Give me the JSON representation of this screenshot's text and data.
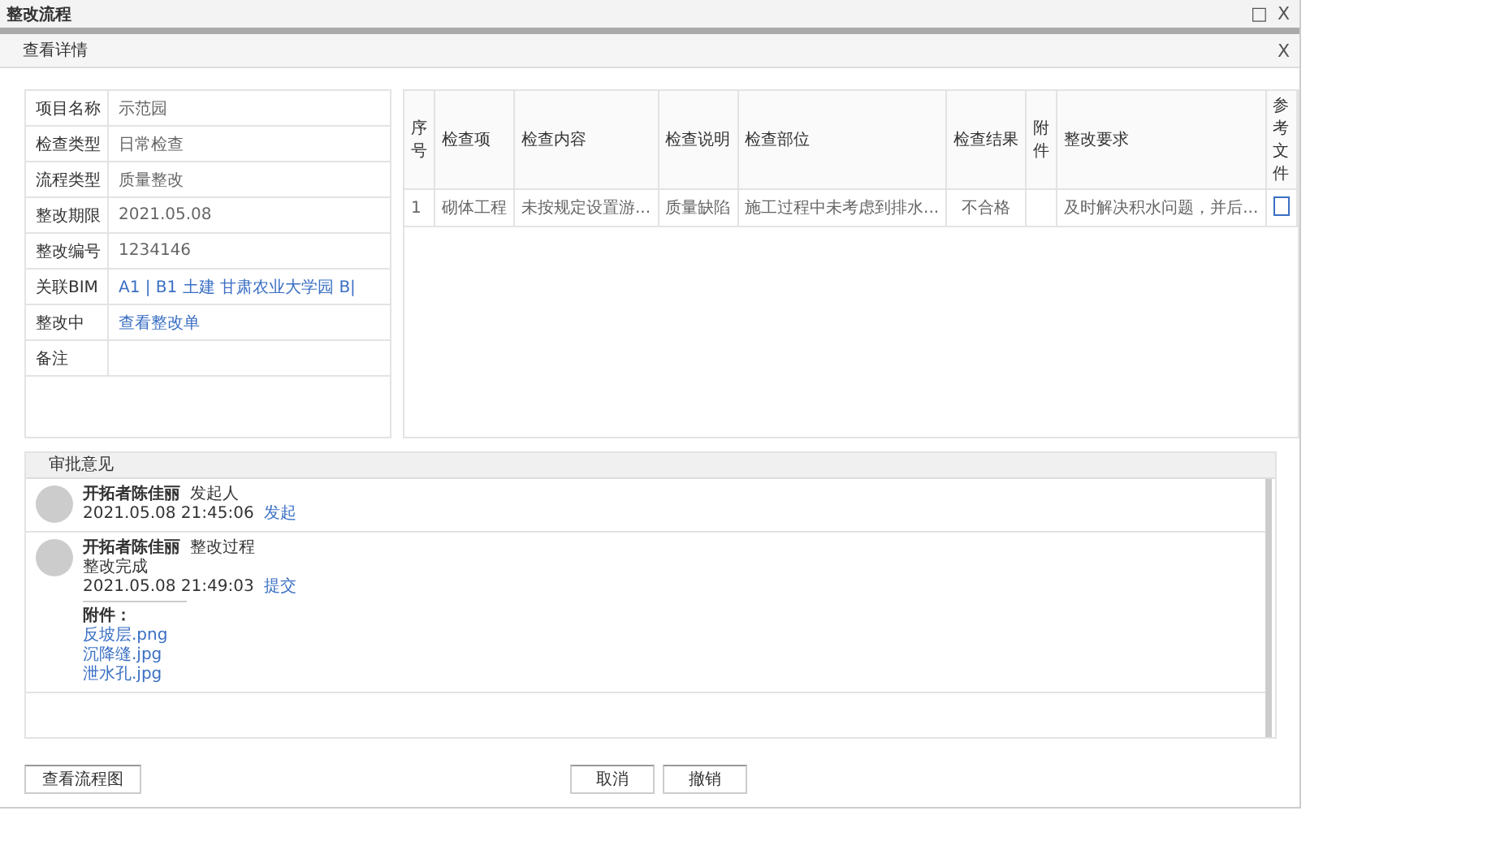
{
  "window": {
    "title": "整改流程",
    "controls": [
      "□",
      "X"
    ]
  },
  "dialog": {
    "title": "查看详情",
    "close": "X"
  },
  "info": [
    {
      "label": "项目名称",
      "value": "示范园",
      "kind": "text"
    },
    {
      "label": "检查类型",
      "value": "日常检查",
      "kind": "text"
    },
    {
      "label": "流程类型",
      "value": "质量整改",
      "kind": "text"
    },
    {
      "label": "整改期限",
      "value": "2021.05.08",
      "kind": "text"
    },
    {
      "label": "整改编号",
      "value": "1234146",
      "kind": "text"
    },
    {
      "label": "关联BIM",
      "value": "A1 | B1 土建 甘肃农业大学园 B|",
      "kind": "link"
    },
    {
      "label": "整改中",
      "value": "查看整改单",
      "kind": "link"
    },
    {
      "label": "备注"
    }
  ],
  "table": {
    "columns": [
      "序号",
      "检查项",
      "检查内容",
      "检查说明",
      "检查部位",
      "检查结果",
      "附件",
      "整改要求",
      "参考文件"
    ],
    "rows": [
      {
        "cells": [
          "1",
          "砌体工程",
          "未按规定设置游...",
          "质量缺陷",
          "施工过程中未考虑到排水...",
          "不合格",
          "",
          "及时解决积水问题，并后..."
        ],
        "has_file": true
      }
    ]
  },
  "comments": {
    "title": "审批意见",
    "items": [
      {
        "name": "开拓者陈佳丽",
        "role": "发起人",
        "time": "2021.05.08 21:45:06",
        "action": "发起"
      },
      {
        "name": "开拓者陈佳丽",
        "role": "整改过程",
        "note": "整改完成",
        "time": "2021.05.08 21:49:03",
        "action": "提交",
        "attachments_label": "附件：",
        "attachments": [
          "反坡层.png",
          "沉降缝.jpg",
          "泄水孔.jpg"
        ]
      }
    ]
  },
  "buttons": {
    "left": "查看流程图",
    "right": [
      "取消",
      "撤销"
    ]
  }
}
